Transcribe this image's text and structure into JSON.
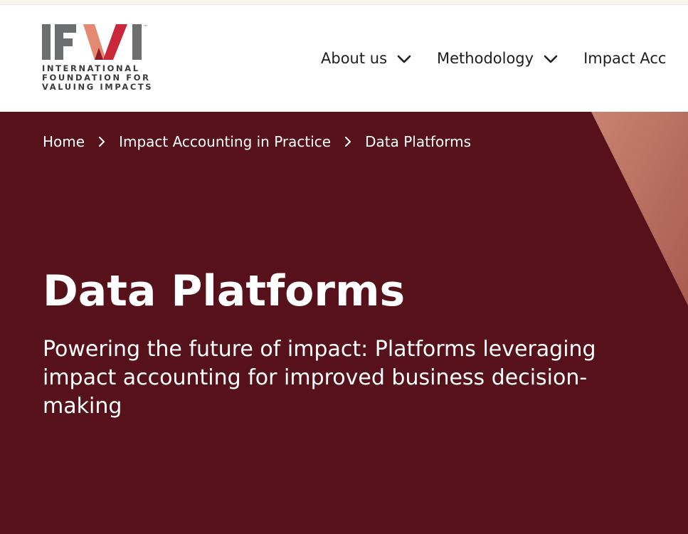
{
  "logo": {
    "letters": "IFVI",
    "trademark": "™",
    "tagline_lines": [
      "INTERNATIONAL",
      "FOUNDATION FOR",
      "VALUING IMPACTS"
    ],
    "colors": {
      "grey": "#6d6e70",
      "salmon": "#e48a73",
      "red": "#c8283a"
    }
  },
  "nav": {
    "items": [
      {
        "label": "About us",
        "icon": "chevron-down-icon"
      },
      {
        "label": "Methodology",
        "icon": "chevron-down-icon"
      },
      {
        "label": "Impact Acc"
      }
    ]
  },
  "breadcrumb": {
    "items": [
      "Home",
      "Impact Accounting in Practice",
      "Data Platforms"
    ],
    "separator_icon": "chevron-right-icon"
  },
  "hero": {
    "title": "Data Platforms",
    "subtitle": "Powering the future of impact: Platforms leveraging impact accounting for improved business decision-making",
    "background_color": "#56111a",
    "accent_color": "#c9836f"
  }
}
